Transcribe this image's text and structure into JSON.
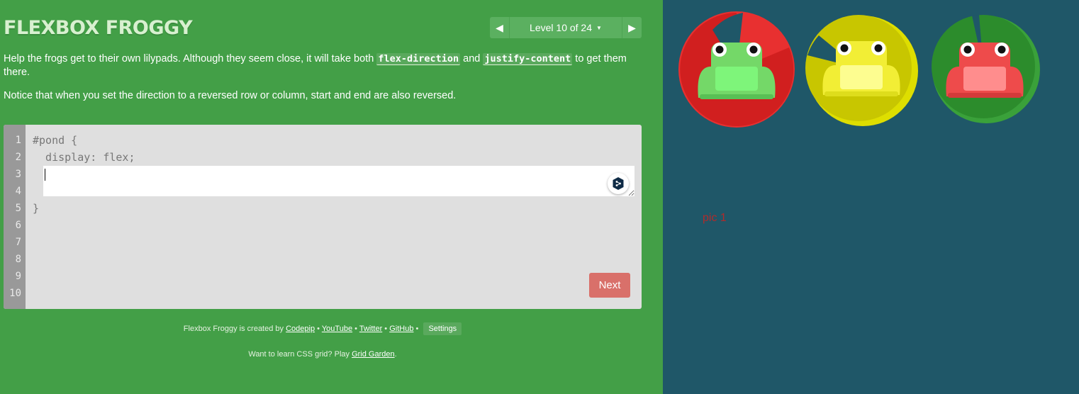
{
  "header": {
    "title": "FLEXBOX FROGGY",
    "level_label": "Level 10 of 24",
    "prev_icon": "triangle-left-icon",
    "next_icon": "triangle-right-icon",
    "caret_icon": "caret-down-icon"
  },
  "instructions": {
    "p1_before": "Help the frogs get to their own lilypads. Although they seem close, it will take both ",
    "p1_code1": "flex-direction",
    "p1_mid": " and ",
    "p1_code2": "justify-content",
    "p1_after": " to get them there.",
    "p2": "Notice that when you set the direction to a reversed row or column, start and end are also reversed."
  },
  "editor": {
    "line_numbers": [
      "1",
      "2",
      "3",
      "4",
      "5",
      "6",
      "7",
      "8",
      "9",
      "10"
    ],
    "line1": "#pond {",
    "line2": "  display: flex;",
    "line5": "}",
    "input_value": "",
    "translate_icon": "deepl-translate-icon",
    "next_label": "Next"
  },
  "footer": {
    "credit_prefix": "Flexbox Froggy is created by ",
    "link_codepip": "Codepip",
    "sep": " • ",
    "link_youtube": "YouTube",
    "link_twitter": "Twitter",
    "link_github": "GitHub",
    "settings_label": "Settings",
    "grid_prefix": "Want to learn CSS grid? Play ",
    "grid_link": "Grid Garden",
    "grid_suffix": "."
  },
  "board": {
    "pic_label": "pic 1",
    "frogs": [
      {
        "color": "red",
        "frog_body": "#74d868",
        "frog_light": "#7ef57a",
        "pad": "#d11f1f",
        "pad_edge": "#e83030"
      },
      {
        "color": "yellow",
        "frog_body": "#f2ee35",
        "frog_light": "#fdfd90",
        "pad": "#c8c600",
        "pad_edge": "#dede00"
      },
      {
        "color": "green",
        "frog_body": "#ee4b4b",
        "frog_light": "#ff8d8d",
        "pad": "#2c8c2c",
        "pad_edge": "#3aa13a"
      }
    ]
  },
  "colors": {
    "game_bg": "#439f47",
    "board_bg": "#1f5768",
    "next_button": "#d9706a"
  }
}
